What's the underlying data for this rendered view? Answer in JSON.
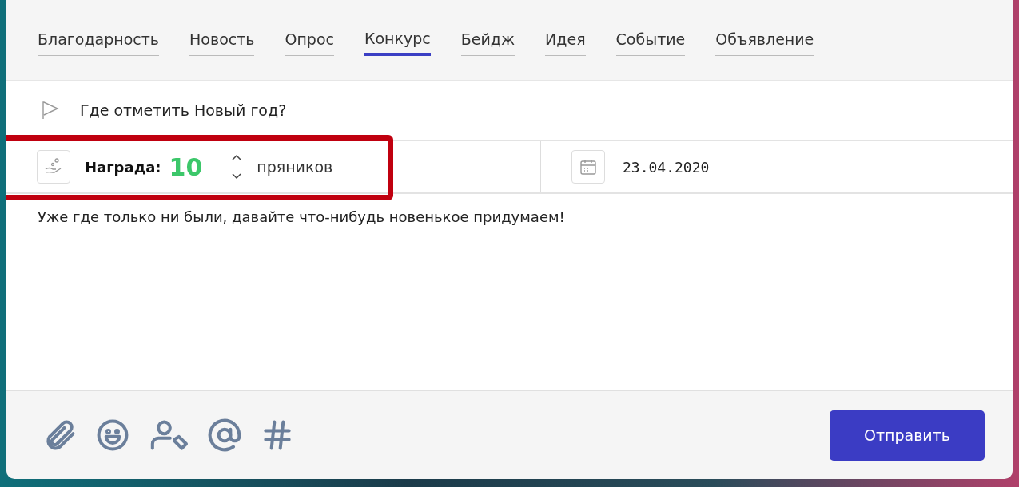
{
  "tabs": [
    {
      "label": "Благодарность",
      "selected": false
    },
    {
      "label": "Новость",
      "selected": false
    },
    {
      "label": "Опрос",
      "selected": false
    },
    {
      "label": "Конкурс",
      "selected": true
    },
    {
      "label": "Бейдж",
      "selected": false
    },
    {
      "label": "Идея",
      "selected": false
    },
    {
      "label": "Событие",
      "selected": false
    },
    {
      "label": "Объявление",
      "selected": false
    }
  ],
  "title_field": {
    "value": "Где отметить Новый год?"
  },
  "reward": {
    "label": "Награда:",
    "value": "10",
    "unit": "пряников",
    "highlighted": true
  },
  "date_field": {
    "value": "23.04.2020"
  },
  "body": {
    "value": "Уже где только ни были, давайте что-нибудь новенькое придумаем!"
  },
  "toolbar": [
    {
      "kind": "attach"
    },
    {
      "kind": "emoji"
    },
    {
      "kind": "user-tag"
    },
    {
      "kind": "mention"
    },
    {
      "kind": "hashtag"
    }
  ],
  "submit_button": {
    "label": "Отправить"
  }
}
